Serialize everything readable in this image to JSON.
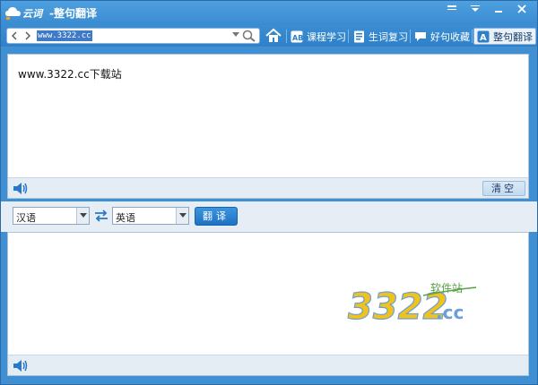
{
  "window": {
    "title": "-整句翻译"
  },
  "toolbar": {
    "url": "www.3322.cc",
    "buttons": [
      {
        "label": "课程学习",
        "icon": "ab-course-icon"
      },
      {
        "label": "生词复习",
        "icon": "notebook-icon"
      },
      {
        "label": "好句收藏",
        "icon": "chat-bubble-icon"
      },
      {
        "label": "整句翻译",
        "icon": "translate-a-icon",
        "active": true
      }
    ]
  },
  "input": {
    "text": "www.3322.cc下载站",
    "clear_label": "清空"
  },
  "language": {
    "source": "汉语",
    "target": "英语",
    "translate_label": "翻译"
  },
  "watermark": {
    "number": "3322",
    "suffix": ".cc",
    "tag": "软件站"
  },
  "colors": {
    "accent": "#3a8bd0",
    "active_tab": "#e9f1fa",
    "button": "#1d72c4"
  }
}
